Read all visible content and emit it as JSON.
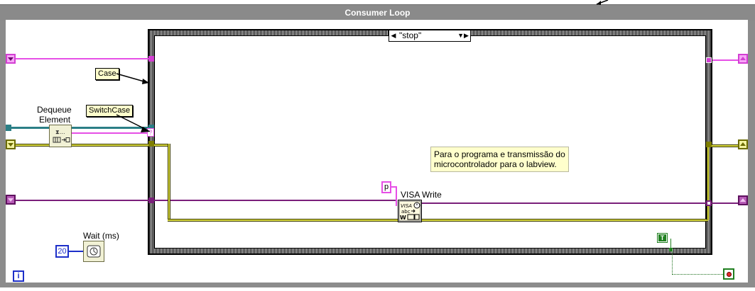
{
  "loop": {
    "title": "Consumer Loop",
    "iteration_label": "i"
  },
  "case_structure": {
    "selector_value": "\"stop\"",
    "prev_arrow": "◀",
    "next_arrow": "▼▶"
  },
  "labels": {
    "dequeue_line1": "Dequeue",
    "dequeue_line2": "Element",
    "case_tag": "Case",
    "switchcase_tag": "SwitchCase",
    "visa_write": "VISA Write",
    "wait_ms": "Wait (ms)"
  },
  "comment": {
    "line1": "Para o programa e transmissão do",
    "line2": "microcontrolador para o labview."
  },
  "constants": {
    "wait_value": "20",
    "string_value": "p",
    "bool_value": "T",
    "selector_terminal": "?"
  },
  "icons": {
    "dequeue": "dequeue-element-icon",
    "visa_write": "visa-write-icon",
    "wait": "wait-ms-icon",
    "stop": "stop-condition-icon",
    "iteration": "iteration-terminal-icon"
  },
  "colors": {
    "loop_border": "#8c8c8c",
    "string_wire": "#e64fe6",
    "visa_wire": "#7a1f7a",
    "error_wire": "#d8d840",
    "queue_wire": "#2b7f86",
    "bool_wire": "#1f7f1f",
    "numeric": "#1d2fc9",
    "comment_bg": "#ffffcc"
  }
}
